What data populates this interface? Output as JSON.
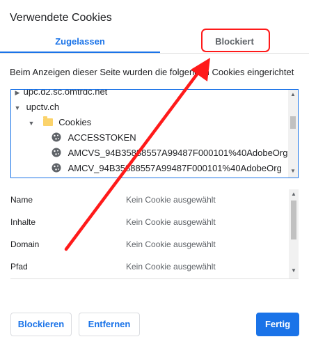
{
  "dialog": {
    "title": "Verwendete Cookies",
    "tabs": [
      {
        "label": "Zugelassen",
        "active": true
      },
      {
        "label": "Blockiert",
        "active": false
      }
    ],
    "info_text": "Beim Anzeigen dieser Seite wurden die folgenden Cookies eingerichtet"
  },
  "tree": {
    "rows": [
      {
        "label": "upc.d2.sc.omtrdc.net",
        "type": "site-collapsed"
      },
      {
        "label": "upctv.ch",
        "type": "site-expanded"
      },
      {
        "label": "Cookies",
        "type": "folder"
      },
      {
        "label": "ACCESSTOKEN",
        "type": "cookie"
      },
      {
        "label": "AMCVS_94B35888557A99487F000101%40AdobeOrg",
        "type": "cookie"
      },
      {
        "label": "AMCV_94B35888557A99487F000101%40AdobeOrg",
        "type": "cookie"
      }
    ]
  },
  "details": {
    "rows": [
      {
        "label": "Name",
        "value": "Kein Cookie ausgewählt"
      },
      {
        "label": "Inhalte",
        "value": "Kein Cookie ausgewählt"
      },
      {
        "label": "Domain",
        "value": "Kein Cookie ausgewählt"
      },
      {
        "label": "Pfad",
        "value": "Kein Cookie ausgewählt"
      }
    ]
  },
  "buttons": {
    "block": "Blockieren",
    "remove": "Entfernen",
    "done": "Fertig"
  },
  "colors": {
    "accent": "#1a73e8",
    "annotation": "#ff1a1a"
  }
}
